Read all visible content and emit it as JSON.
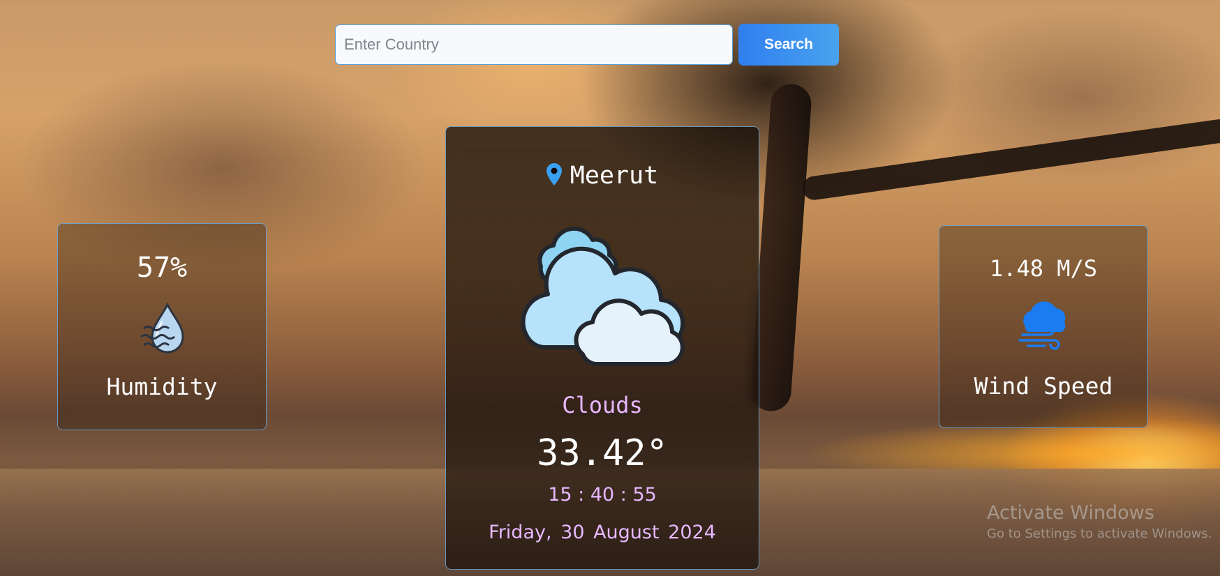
{
  "search": {
    "placeholder": "Enter Country",
    "value": "",
    "button_label": "Search",
    "button_color": "#2f7ff0"
  },
  "humidity": {
    "value": "57%",
    "label": "Humidity",
    "icon": "humidity-drop-icon"
  },
  "weather": {
    "city": "Meerut",
    "location_icon": "map-pin-icon",
    "icon": "clouds-icon",
    "condition": "Clouds",
    "temperature": "33.42°",
    "time": "15 : 40 : 55",
    "date": "Friday, 30 August 2024",
    "accent_color": "#e7b8ff"
  },
  "wind": {
    "value": "1.48 M/S",
    "label": "Wind Speed",
    "icon": "wind-cloud-icon"
  },
  "watermark": {
    "title": "Activate Windows",
    "subtitle": "Go to Settings to activate Windows."
  }
}
